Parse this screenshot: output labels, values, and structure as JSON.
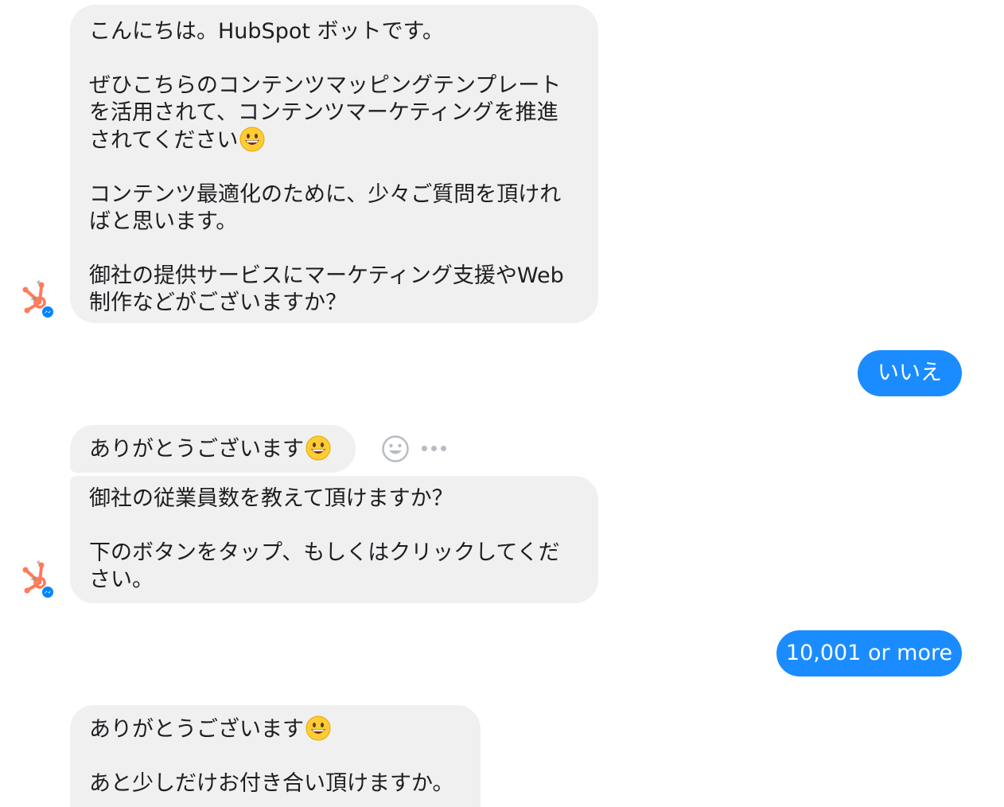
{
  "messages": {
    "bot1": {
      "line1": "こんにちは。HubSpot ボットです。",
      "line2": "ぜひこちらのコンテンツマッピングテンプレート",
      "line3": "を活用されて、コンテンツマーケティングを推進",
      "line4": "されてください",
      "line5": "コンテンツ最適化のために、少々ご質問を頂けれ",
      "line6": "ばと思います。",
      "line7": "御社の提供サービスにマーケティング支援やWeb",
      "line8": "制作などがございますか？"
    },
    "user1": "いいえ",
    "bot2": "ありがとうございます",
    "bot3": {
      "line1": "御社の従業員数を教えて頂けますか？",
      "line2": "下のボタンをタップ、もしくはクリックしてくだ",
      "line3": "さい。"
    },
    "user2": "10,001 or more",
    "bot4": {
      "line1": "ありがとうございます",
      "line2": "あと少しだけお付き合い頂けますか。"
    }
  },
  "icons": {
    "emoji": "grinning-face-emoji",
    "reaction": "smiley-reaction-icon",
    "more": "more-options-icon",
    "avatar": "hubspot-logo-avatar",
    "messenger_badge": "messenger-badge-icon"
  },
  "colors": {
    "incoming_bubble": "#f0f0f0",
    "outgoing_bubble": "#1a8cff",
    "hubspot_orange": "#ff7a59",
    "messenger_blue": "#0084ff"
  }
}
